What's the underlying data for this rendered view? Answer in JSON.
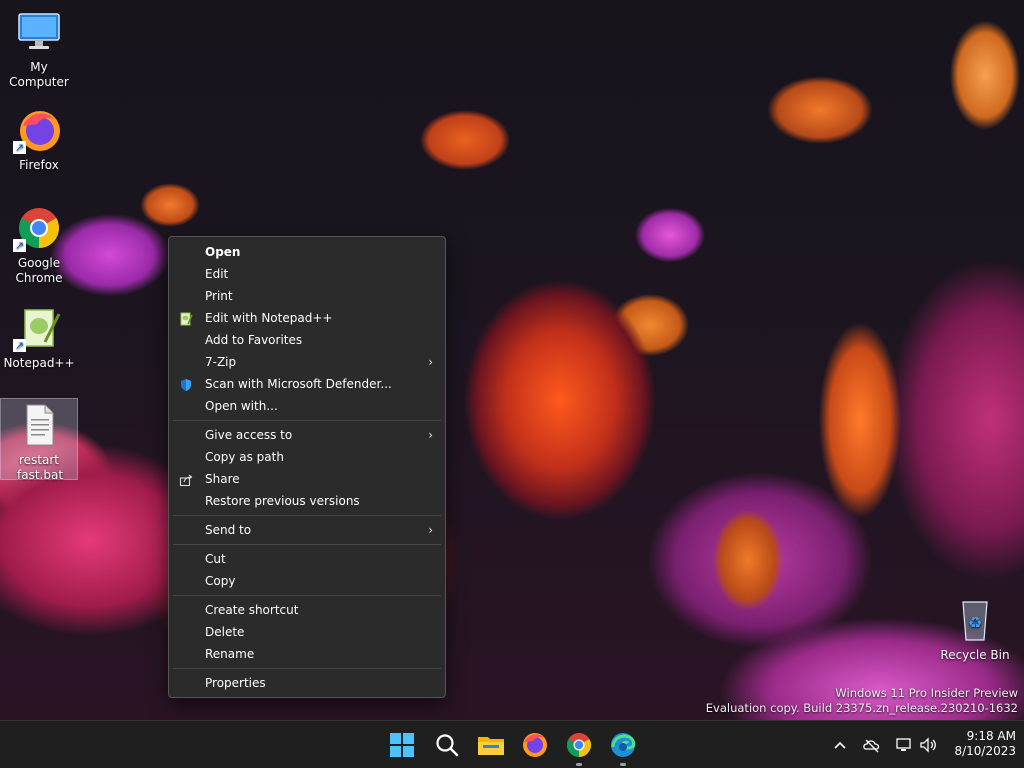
{
  "desktop": {
    "icons": [
      {
        "label": "My Computer"
      },
      {
        "label": "Firefox"
      },
      {
        "label": "Google Chrome"
      },
      {
        "label": "Notepad++"
      },
      {
        "label": "restart fast.bat"
      },
      {
        "label": "Recycle Bin"
      }
    ]
  },
  "context_menu": {
    "groups": [
      [
        {
          "label": "Open",
          "icon": "",
          "submenu": false
        },
        {
          "label": "Edit",
          "icon": "",
          "submenu": false
        },
        {
          "label": "Print",
          "icon": "",
          "submenu": false
        },
        {
          "label": "Edit with Notepad++",
          "icon": "notepadpp-icon",
          "submenu": false
        },
        {
          "label": "Add to Favorites",
          "icon": "",
          "submenu": false
        },
        {
          "label": "7-Zip",
          "icon": "",
          "submenu": true
        },
        {
          "label": "Scan with Microsoft Defender...",
          "icon": "defender-shield-icon",
          "submenu": false
        },
        {
          "label": "Open with...",
          "icon": "",
          "submenu": false
        }
      ],
      [
        {
          "label": "Give access to",
          "icon": "",
          "submenu": true
        },
        {
          "label": "Copy as path",
          "icon": "",
          "submenu": false
        },
        {
          "label": "Share",
          "icon": "share-icon",
          "submenu": false
        },
        {
          "label": "Restore previous versions",
          "icon": "",
          "submenu": false
        }
      ],
      [
        {
          "label": "Send to",
          "icon": "",
          "submenu": true
        }
      ],
      [
        {
          "label": "Cut",
          "icon": "",
          "submenu": false
        },
        {
          "label": "Copy",
          "icon": "",
          "submenu": false
        }
      ],
      [
        {
          "label": "Create shortcut",
          "icon": "",
          "submenu": false
        },
        {
          "label": "Delete",
          "icon": "",
          "submenu": false
        },
        {
          "label": "Rename",
          "icon": "",
          "submenu": false
        }
      ],
      [
        {
          "label": "Properties",
          "icon": "",
          "submenu": false
        }
      ]
    ]
  },
  "watermark": {
    "line1": "Windows 11 Pro Insider Preview",
    "line2": "Evaluation copy. Build 23375.zn_release.230210-1632"
  },
  "taskbar": {
    "apps": [
      "start-icon",
      "search-icon",
      "file-explorer-icon",
      "firefox-icon",
      "chrome-icon",
      "edge-icon"
    ],
    "tray": [
      "chevron-up-icon",
      "onedrive-offline-icon",
      "network-icon",
      "volume-icon"
    ],
    "time": "9:18 AM",
    "date": "8/10/2023"
  }
}
